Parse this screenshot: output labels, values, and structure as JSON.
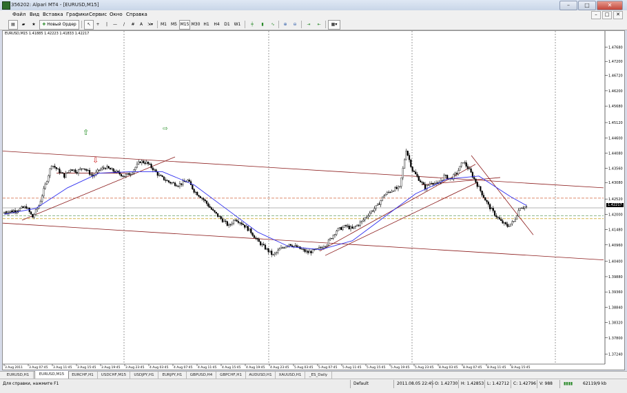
{
  "window": {
    "title": "356202: Alpari MT4 - [EURUSD,M15]",
    "min": "–",
    "max": "□",
    "close": "✕"
  },
  "menu": [
    "Файл",
    "Вид",
    "Вставка",
    "Графики",
    "Сервис",
    "Окно",
    "Справка"
  ],
  "toolbar": {
    "new_order": "Новый Ордер",
    "timeframes": [
      "M1",
      "M5",
      "M15",
      "M30",
      "H1",
      "H4",
      "D1",
      "W1"
    ],
    "active_timeframe": "M15"
  },
  "chart_header": "EURUSD,M15  1.41885 1.42223 1.41833 1.42217",
  "bid_label": "1.42217",
  "left_label": "#12183",
  "tabs": [
    {
      "label": "EURUSD,H1",
      "active": false
    },
    {
      "label": "EURUSD,M15",
      "active": true
    },
    {
      "label": "EURCHF,H1",
      "active": false
    },
    {
      "label": "USDCHF,M15",
      "active": false
    },
    {
      "label": "USDJPY,H1",
      "active": false
    },
    {
      "label": "EURJPY,H1",
      "active": false
    },
    {
      "label": "GBPUSD,H4",
      "active": false
    },
    {
      "label": "GBPCHF,H1",
      "active": false
    },
    {
      "label": "AUDUSD,H1",
      "active": false
    },
    {
      "label": "XAUUSD,H1",
      "active": false
    },
    {
      "label": "_ES_Daily",
      "active": false
    }
  ],
  "status": {
    "help": "Для справки, нажмите F1",
    "profile": "Default",
    "datetime": "2011.08.05 22:45",
    "open": "O: 1.42730",
    "high": "H: 1.42853",
    "low": "L: 1.42712",
    "close": "C: 1.42796",
    "volume": "V: 988",
    "traffic": "62119/9 kb"
  },
  "colors": {
    "up_candle": "#000000",
    "ma": "#2c2cf0",
    "trend": "#8b1a1a",
    "arrow_up": "#1a8a1a",
    "arrow_down": "#d02020",
    "hline_orange": "#d0603a",
    "hline_green": "#6aa36a",
    "hline_gold": "#c8a018"
  },
  "chart_data": {
    "type": "candlestick",
    "symbol": "EURUSD",
    "timeframe": "M15",
    "ylim": [
      1.37,
      1.48
    ],
    "yticks": [
      "1.47680",
      "1.47200",
      "1.46720",
      "1.46200",
      "1.45680",
      "1.45120",
      "1.44600",
      "1.44080",
      "1.43560",
      "1.43080",
      "1.42520",
      "1.42000",
      "1.41480",
      "1.40960",
      "1.40400",
      "1.39880",
      "1.39360",
      "1.38840",
      "1.38320",
      "1.37800",
      "1.37240"
    ],
    "xticks": [
      "3 Aug 2011",
      "3 Aug 07:45",
      "3 Aug 11:45",
      "3 Aug 15:45",
      "3 Aug 19:45",
      "3 Aug 23:45",
      "4 Aug 03:45",
      "4 Aug 07:45",
      "4 Aug 11:45",
      "4 Aug 15:45",
      "4 Aug 19:45",
      "4 Aug 23:45",
      "5 Aug 03:45",
      "5 Aug 07:45",
      "5 Aug 11:45",
      "5 Aug 15:45",
      "5 Aug 19:45",
      "5 Aug 23:45",
      "8 Aug 03:45",
      "8 Aug 07:45",
      "8 Aug 11:45",
      "8 Aug 15:45"
    ],
    "close_path": [
      [
        0,
        1.4205
      ],
      [
        8,
        1.4215
      ],
      [
        14,
        1.4225
      ],
      [
        18,
        1.419
      ],
      [
        22,
        1.423
      ],
      [
        26,
        1.43
      ],
      [
        30,
        1.437
      ],
      [
        34,
        1.435
      ],
      [
        38,
        1.433
      ],
      [
        42,
        1.4355
      ],
      [
        46,
        1.4345
      ],
      [
        50,
        1.436
      ],
      [
        56,
        1.433
      ],
      [
        60,
        1.435
      ],
      [
        64,
        1.436
      ],
      [
        70,
        1.4345
      ],
      [
        76,
        1.433
      ],
      [
        80,
        1.434
      ],
      [
        86,
        1.438
      ],
      [
        90,
        1.4375
      ],
      [
        94,
        1.4355
      ],
      [
        98,
        1.433
      ],
      [
        104,
        1.431
      ],
      [
        110,
        1.43
      ],
      [
        116,
        1.4315
      ],
      [
        120,
        1.428
      ],
      [
        126,
        1.425
      ],
      [
        132,
        1.421
      ],
      [
        138,
        1.418
      ],
      [
        142,
        1.416
      ],
      [
        146,
        1.4185
      ],
      [
        150,
        1.417
      ],
      [
        156,
        1.414
      ],
      [
        160,
        1.411
      ],
      [
        166,
        1.408
      ],
      [
        170,
        1.406
      ],
      [
        174,
        1.408
      ],
      [
        180,
        1.41
      ],
      [
        186,
        1.4085
      ],
      [
        192,
        1.407
      ],
      [
        198,
        1.408
      ],
      [
        204,
        1.41
      ],
      [
        210,
        1.4145
      ],
      [
        216,
        1.416
      ],
      [
        220,
        1.415
      ],
      [
        226,
        1.4175
      ],
      [
        230,
        1.42
      ],
      [
        236,
        1.423
      ],
      [
        240,
        1.4265
      ],
      [
        246,
        1.4285
      ],
      [
        250,
        1.429
      ],
      [
        254,
        1.442
      ],
      [
        258,
        1.435
      ],
      [
        262,
        1.432
      ],
      [
        266,
        1.429
      ],
      [
        270,
        1.431
      ],
      [
        274,
        1.43
      ],
      [
        278,
        1.433
      ],
      [
        282,
        1.432
      ],
      [
        286,
        1.434
      ],
      [
        290,
        1.438
      ],
      [
        294,
        1.435
      ],
      [
        298,
        1.431
      ],
      [
        302,
        1.427
      ],
      [
        306,
        1.423
      ],
      [
        310,
        1.42
      ],
      [
        314,
        1.4175
      ],
      [
        318,
        1.416
      ],
      [
        322,
        1.4175
      ],
      [
        326,
        1.4225
      ]
    ],
    "ma_path": [
      [
        0,
        1.42
      ],
      [
        20,
        1.422
      ],
      [
        40,
        1.429
      ],
      [
        60,
        1.434
      ],
      [
        80,
        1.4345
      ],
      [
        100,
        1.4345
      ],
      [
        120,
        1.43
      ],
      [
        140,
        1.422
      ],
      [
        160,
        1.414
      ],
      [
        180,
        1.409
      ],
      [
        200,
        1.408
      ],
      [
        220,
        1.411
      ],
      [
        240,
        1.419
      ],
      [
        260,
        1.427
      ],
      [
        280,
        1.432
      ],
      [
        300,
        1.433
      ],
      [
        320,
        1.426
      ],
      [
        330,
        1.423
      ]
    ],
    "vlines_x": [
      76,
      164,
      253,
      342
    ],
    "price_range": {
      "low": 1.37,
      "high": 1.48
    },
    "grid": false
  }
}
